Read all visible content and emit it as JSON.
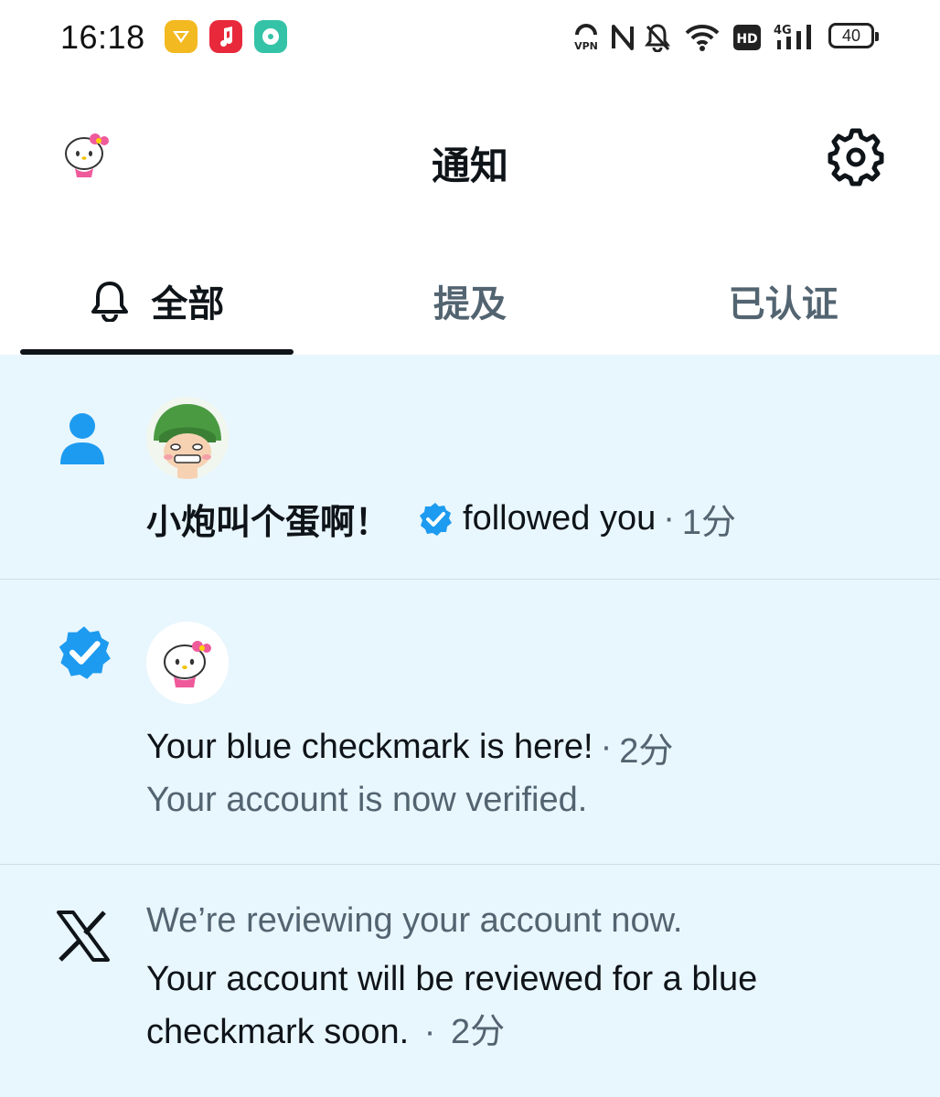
{
  "status_bar": {
    "time": "16:18",
    "battery": "40",
    "network": "4G",
    "hd": "HD",
    "vpn": "VPN",
    "icons": [
      "gift-app-icon",
      "music-app-icon",
      "media-app-icon",
      "vpn-icon",
      "nfc-icon",
      "bell-mute-icon",
      "wifi-icon",
      "hd-icon",
      "signal-icon",
      "battery-icon"
    ]
  },
  "header": {
    "title": "通知",
    "avatar_icon": "hello-kitty-avatar",
    "settings_icon": "gear-icon"
  },
  "tabs": [
    {
      "label": "全部",
      "active": true,
      "icon": "bell-icon"
    },
    {
      "label": "提及",
      "active": false
    },
    {
      "label": "已认证",
      "active": false
    }
  ],
  "notifications": [
    {
      "type_icon": "person-icon",
      "avatar": "green-helmet-cartoon-avatar",
      "user": "小炮叫个蛋啊！",
      "verified_icon": "verified-badge-icon",
      "action": "followed you",
      "sep": "·",
      "time": "1分"
    },
    {
      "type_icon": "verified-badge-icon",
      "avatar": "hello-kitty-avatar",
      "title": "Your blue checkmark is here!",
      "sep": "·",
      "time": "2分",
      "subtitle": "Your account is now verified."
    },
    {
      "type_icon": "x-logo-icon",
      "subtitle": "We’re reviewing your account now.",
      "body": "Your account will be reviewed for a blue checkmark soon.",
      "sep": "·",
      "time": "2分"
    }
  ],
  "colors": {
    "accent": "#1d9bf0",
    "highlight_bg": "#e8f6fd",
    "text": "#0f1419",
    "muted": "#536471"
  }
}
